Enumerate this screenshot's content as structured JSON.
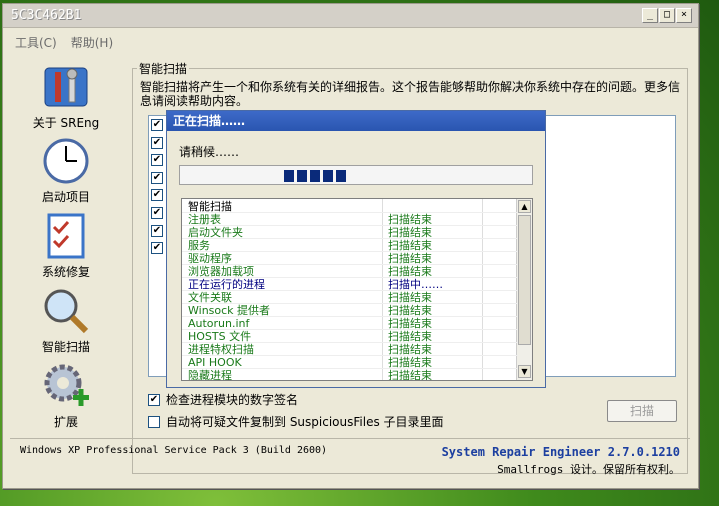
{
  "window": {
    "title": "5C3C462B1"
  },
  "menu": [
    {
      "label": "工具(C)"
    },
    {
      "label": "帮助(H)"
    }
  ],
  "sidebar": {
    "items": [
      {
        "label": "关于 SREng",
        "icon": "tools-icon"
      },
      {
        "label": "启动项目",
        "icon": "clock-icon"
      },
      {
        "label": "系统修复",
        "icon": "checklist-icon"
      },
      {
        "label": "智能扫描",
        "icon": "magnifier-icon"
      },
      {
        "label": "扩展",
        "icon": "gear-plus-icon"
      }
    ]
  },
  "main": {
    "group_title": "智能扫描",
    "description": "智能扫描将产生一个和你系统有关的详细报告。这个报告能够帮助你解决你系统中存在的问题。更多信息请阅读帮助内容。",
    "check_count": 8,
    "options": [
      {
        "label": "检查进程模块的数字签名",
        "checked": true
      },
      {
        "label": "自动将可疑文件复制到 SuspiciousFiles 子目录里面",
        "checked": false
      }
    ],
    "scan_button": "扫描"
  },
  "status": {
    "os": "Windows XP Professional Service Pack 3 (Build 2600)",
    "product": "System Repair Engineer 2.7.0.1210",
    "copyright": "Smallfrogs 设计。保留所有权利。"
  },
  "dialog": {
    "title": "正在扫描……",
    "wait": "请稍候……",
    "progress_blocks": 5,
    "rows": [
      {
        "name": "智能扫描",
        "status": ""
      },
      {
        "name": "注册表",
        "status": "扫描结束"
      },
      {
        "name": "启动文件夹",
        "status": "扫描结束"
      },
      {
        "name": "服务",
        "status": "扫描结束"
      },
      {
        "name": "驱动程序",
        "status": "扫描结束"
      },
      {
        "name": "浏览器加载项",
        "status": "扫描结束"
      },
      {
        "name": "正在运行的进程",
        "status": "扫描中……"
      },
      {
        "name": "文件关联",
        "status": "扫描结束"
      },
      {
        "name": "Winsock 提供者",
        "status": "扫描结束"
      },
      {
        "name": "Autorun.inf",
        "status": "扫描结束"
      },
      {
        "name": "HOSTS 文件",
        "status": "扫描结束"
      },
      {
        "name": "进程特权扫描",
        "status": "扫描结束"
      },
      {
        "name": "API HOOK",
        "status": "扫描结束"
      },
      {
        "name": "隐藏进程",
        "status": "扫描结束"
      }
    ]
  },
  "colors": {
    "done": "#1a7a1a",
    "active": "#000080",
    "title_blue": "#1c3fa0"
  }
}
